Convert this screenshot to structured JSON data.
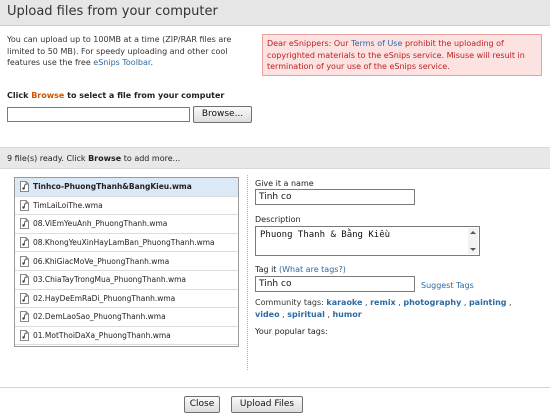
{
  "header": {
    "title": "Upload files from your computer"
  },
  "intro": {
    "text_before_link": "You can upload up to 100MB at a time (ZIP/RAR files are limited to 50 MB). For speedy uploading and other cool features use the free ",
    "toolbar_link": "eSnips Toolbar",
    "text_after_link": "."
  },
  "warning": {
    "text_before_link": "Dear eSnippers: Our ",
    "terms_link": "Terms of Use",
    "text_after_link": " prohibit the uploading of copyrighted materials to the eSnips service. Misuse will result in termination of your use of the eSnips service."
  },
  "select": {
    "prefix": "Click ",
    "browse_word": "Browse",
    "suffix": " to select a file from your computer",
    "file_value": "",
    "browse_button": "Browse..."
  },
  "status": {
    "prefix": "9 file(s) ready. Click ",
    "browse_word": "Browse",
    "suffix": " to add more..."
  },
  "files": [
    {
      "name": "Tinhco-PhuongThanh&BangKieu.wma",
      "selected": true
    },
    {
      "name": "TimLaiLoiThe.wma",
      "selected": false
    },
    {
      "name": "08.ViEmYeuAnh_PhuongThanh.wma",
      "selected": false
    },
    {
      "name": "08.KhongYeuXinHayLamBan_PhuongThanh.wma",
      "selected": false
    },
    {
      "name": "06.KhiGiacMoVe_PhuongThanh.wma",
      "selected": false
    },
    {
      "name": "03.ChiaTayTrongMua_PhuongThanh.wma",
      "selected": false
    },
    {
      "name": "02.HayDeEmRaDi_PhuongThanh.wma",
      "selected": false
    },
    {
      "name": "02.DemLaoSao_PhuongThanh.wma",
      "selected": false
    },
    {
      "name": "01.MotThoiDaXa_PhuongThanh.wma",
      "selected": false
    }
  ],
  "form": {
    "name_label": "Give it a name",
    "name_value": "Tinh co",
    "description_label": "Description",
    "description_value": "Phuong Thanh & Bằng Kiều",
    "tag_label": "Tag it",
    "tag_help_link": "(What are tags?)",
    "tag_value": "Tinh co",
    "suggest_tags": "Suggest Tags",
    "community_label": "Community tags:",
    "community_tags": [
      "karaoke",
      "remix",
      "photography",
      "painting",
      "video",
      "spiritual",
      "humor"
    ],
    "popular_label": "Your popular tags:"
  },
  "buttons": {
    "close": "Close",
    "upload": "Upload Files"
  },
  "colors": {
    "link": "#2b6aa3",
    "browse_accent": "#cc5500",
    "warning_bg": "#fde2e2",
    "warning_text": "#bb2222",
    "selected_row": "#dbe8f6"
  },
  "icons": {
    "file": "audio-file-icon"
  }
}
